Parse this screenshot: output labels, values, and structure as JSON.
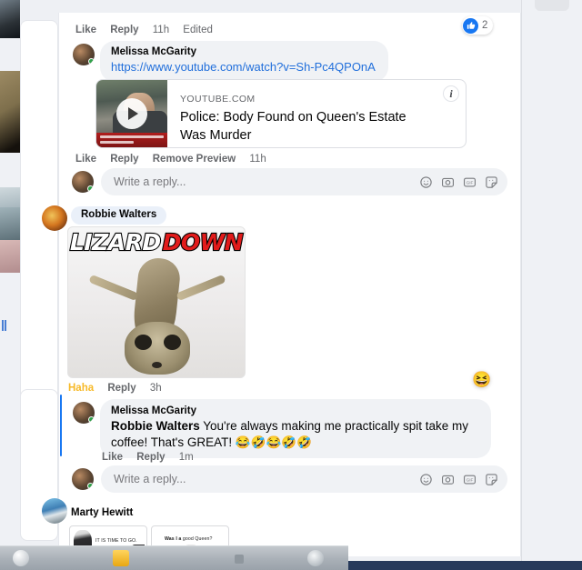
{
  "app": {
    "name": "facebook-comment-thread"
  },
  "colors": {
    "link": "#216fdb",
    "bubble_bg": "#f0f2f5",
    "name_pill_bg": "#eaf0f9",
    "haha_active": "#f7b928",
    "like_blue": "#1877f2",
    "online_green": "#31a24c"
  },
  "comments": {
    "top_actions": {
      "like": "Like",
      "reply": "Reply",
      "timestamp": "11h",
      "edited": "Edited"
    },
    "top_reaction": {
      "icon": "thumbs-up-icon",
      "count": "2"
    },
    "melissa_link_comment": {
      "author": "Melissa McGarity",
      "link_url": "https://www.youtube.com/watch?v=Sh-Pc4QPOnA",
      "preview": {
        "domain": "YOUTUBE.COM",
        "title": "Police: Body Found on Queen's Estate Was Murder",
        "info_icon": "i",
        "play_icon": "play-icon"
      },
      "actions": {
        "like": "Like",
        "reply": "Reply",
        "remove_preview": "Remove Preview",
        "timestamp": "11h"
      }
    },
    "reply_composer_1": {
      "placeholder": "Write a reply...",
      "icons": [
        "emoji-icon",
        "camera-icon",
        "gif-icon",
        "sticker-icon"
      ]
    },
    "robbie_comment": {
      "author": "Robbie Walters",
      "image": {
        "alt": "lizard-down-meme",
        "caption_word_1": "LIZARD",
        "caption_word_2": "DOWN"
      },
      "actions": {
        "reaction": "Haha",
        "reply": "Reply",
        "timestamp": "3h"
      },
      "reaction_emoji": "😆"
    },
    "melissa_reply": {
      "author": "Melissa McGarity",
      "mention": "Robbie Walters",
      "text": " You're always making me practically spit take my coffee! That's GREAT! ",
      "emojis": "😂🤣😂🤣🤣",
      "actions": {
        "like": "Like",
        "reply": "Reply",
        "timestamp": "1m"
      }
    },
    "reply_composer_2": {
      "placeholder": "Write a reply...",
      "icons": [
        "emoji-icon",
        "camera-icon",
        "gif-icon",
        "sticker-icon"
      ]
    },
    "marty_comment": {
      "author": "Marty Hewitt",
      "panels": [
        {
          "caption": "IT IS TIME TO GO."
        },
        {
          "caption_bold": "Was I a",
          "caption_rest": " good Queen?"
        }
      ]
    }
  }
}
